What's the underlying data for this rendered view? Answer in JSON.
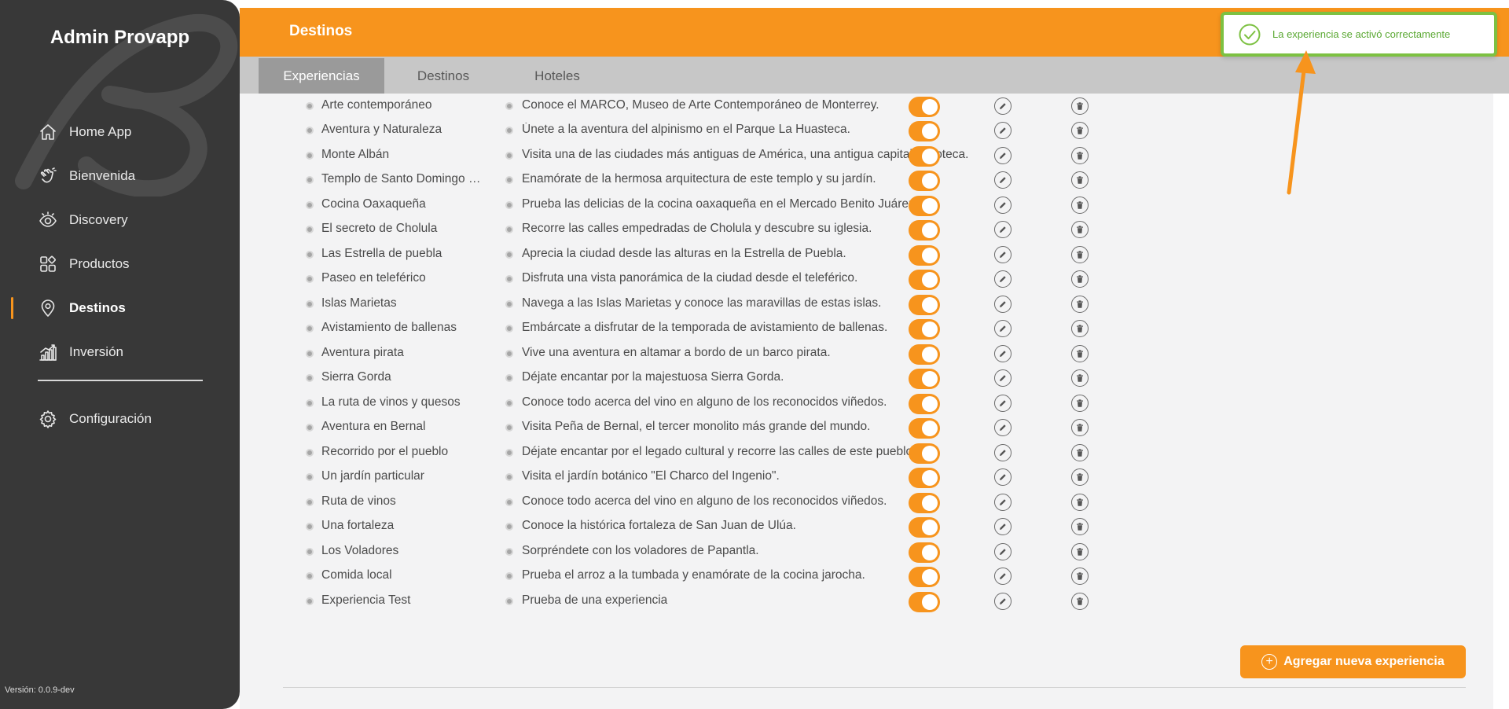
{
  "sidebar": {
    "brand": "Admin Provapp",
    "items": [
      {
        "label": "Home App",
        "icon": "home-icon"
      },
      {
        "label": "Bienvenida",
        "icon": "waving-hand-icon"
      },
      {
        "label": "Discovery",
        "icon": "eye-icon"
      },
      {
        "label": "Productos",
        "icon": "grid-icon"
      },
      {
        "label": "Destinos",
        "icon": "map-pin-icon",
        "active": true
      },
      {
        "label": "Inversión",
        "icon": "bar-chart-icon"
      }
    ],
    "config_label": "Configuración",
    "version": "Versión: 0.0.9-dev"
  },
  "header": {
    "title": "Destinos"
  },
  "tabs": [
    {
      "label": "Experiencias",
      "active": true
    },
    {
      "label": "Destinos"
    },
    {
      "label": "Hoteles"
    }
  ],
  "toast": {
    "message": "La experiencia se activó correctamente",
    "color": "#7dc142"
  },
  "experiences": [
    {
      "name": "Arte contemporáneo",
      "description": "Conoce el MARCO, Museo de Arte Contemporáneo de Monterrey.",
      "active": true
    },
    {
      "name": "Aventura y Naturaleza",
      "description": "Únete a la aventura del alpinismo en el Parque La Huasteca.",
      "active": true
    },
    {
      "name": "Monte Albán",
      "description": "Visita una de las ciudades más antiguas de América, una antigua capital zapoteca.",
      "active": true
    },
    {
      "name": "Templo de Santo Domingo de Guzmán",
      "description": "Enamórate de la hermosa arquitectura de este templo y su jardín.",
      "active": true
    },
    {
      "name": "Cocina Oaxaqueña",
      "description": "Prueba las delicias de la cocina oaxaqueña en el Mercado Benito Juárez.",
      "active": true
    },
    {
      "name": "El secreto de Cholula",
      "description": "Recorre las calles empedradas de Cholula y descubre su iglesia.",
      "active": true
    },
    {
      "name": "Las Estrella de puebla",
      "description": "Aprecia la ciudad desde las alturas en la Estrella de Puebla.",
      "active": true
    },
    {
      "name": "Paseo en teleférico",
      "description": "Disfruta una vista panorámica de la ciudad desde el teleférico.",
      "active": true
    },
    {
      "name": "Islas Marietas",
      "description": "Navega a las Islas Marietas y conoce las maravillas de estas islas.",
      "active": true
    },
    {
      "name": "Avistamiento de ballenas",
      "description": "Embárcate a disfrutar de la temporada de avistamiento de ballenas.",
      "active": true
    },
    {
      "name": "Aventura pirata",
      "description": "Vive una aventura en altamar a bordo de un barco pirata.",
      "active": true
    },
    {
      "name": "Sierra Gorda",
      "description": "Déjate encantar por la majestuosa Sierra Gorda.",
      "active": true
    },
    {
      "name": "La ruta de vinos y quesos",
      "description": "Conoce todo acerca del vino en alguno de los reconocidos viñedos.",
      "active": true
    },
    {
      "name": "Aventura en Bernal",
      "description": "Visita Peña de Bernal, el tercer monolito más grande del mundo.",
      "active": true
    },
    {
      "name": "Recorrido por el pueblo",
      "description": "Déjate encantar por el legado cultural y recorre las calles de este pueblo.",
      "active": true
    },
    {
      "name": "Un jardín particular",
      "description": "Visita el jardín botánico \"El Charco del Ingenio\".",
      "active": true
    },
    {
      "name": "Ruta de vinos",
      "description": "Conoce todo acerca del vino en alguno de los reconocidos viñedos.",
      "active": true
    },
    {
      "name": "Una fortaleza",
      "description": "Conoce la histórica fortaleza de San Juan de Ulúa.",
      "active": true
    },
    {
      "name": "Los Voladores",
      "description": "Sorpréndete con los voladores de Papantla.",
      "active": true
    },
    {
      "name": "Comida local",
      "description": "Prueba el arroz a la tumbada y enamórate de la cocina jarocha.",
      "active": true
    },
    {
      "name": "Experiencia Test",
      "description": "Prueba de una experiencia",
      "active": true
    }
  ],
  "add_button": {
    "label": "Agregar nueva experiencia"
  },
  "colors": {
    "accent": "#f7941d",
    "sidebar": "#383838",
    "success": "#7dc142"
  }
}
